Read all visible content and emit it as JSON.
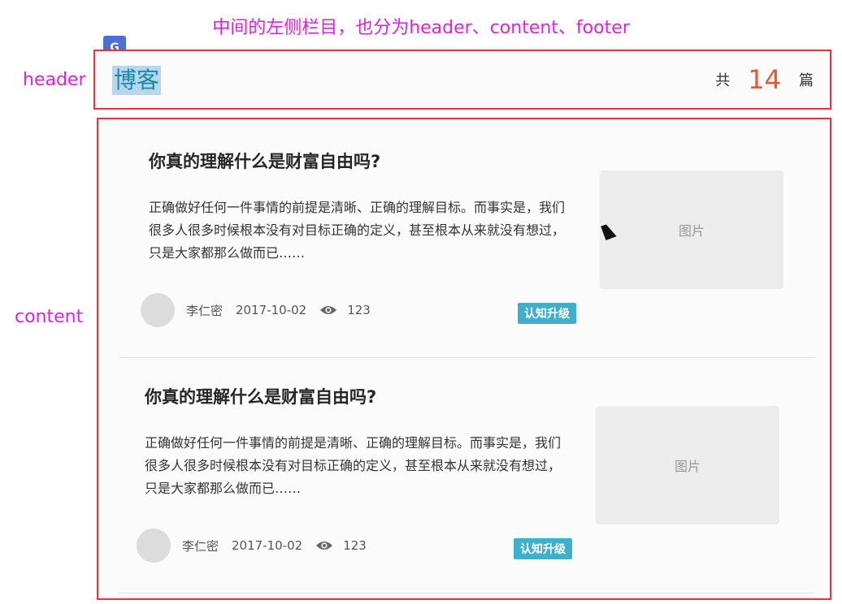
{
  "annotations": {
    "top": "中间的左侧栏目，也分为header、content、footer",
    "header": "header",
    "content": "content"
  },
  "header": {
    "title": "博客",
    "count_prefix": "共",
    "count_value": "14",
    "count_suffix": "篇"
  },
  "articles": [
    {
      "title": "你真的理解什么是财富自由吗?",
      "summary": "正确做好任何一件事情的前提是清晰、正确的理解目标。而事实是，我们很多人很多时候根本没有对目标正确的定义，甚至根本从来就没有想过，只是大家都那么做而已……",
      "author": "李仁密",
      "date": "2017-10-02",
      "views": "123",
      "tag": "认知升级",
      "thumb_label": "图片"
    },
    {
      "title": "你真的理解什么是财富自由吗?",
      "summary": "正确做好任何一件事情的前提是清晰、正确的理解目标。而事实是，我们很多人很多时候根本没有对目标正确的定义，甚至根本从来就没有想过，只是大家都那么做而已……",
      "author": "李仁密",
      "date": "2017-10-02",
      "views": "123",
      "tag": "认知升级",
      "thumb_label": "图片"
    }
  ],
  "colors": {
    "annotation": "#e020e0",
    "frame": "#e8333a",
    "count": "#e05a2b",
    "tag_bg": "#3fb0cc",
    "title_link": "#1a8ba3"
  },
  "icons": [
    "app-icon",
    "eye-icon",
    "mouse-cursor-icon"
  ]
}
